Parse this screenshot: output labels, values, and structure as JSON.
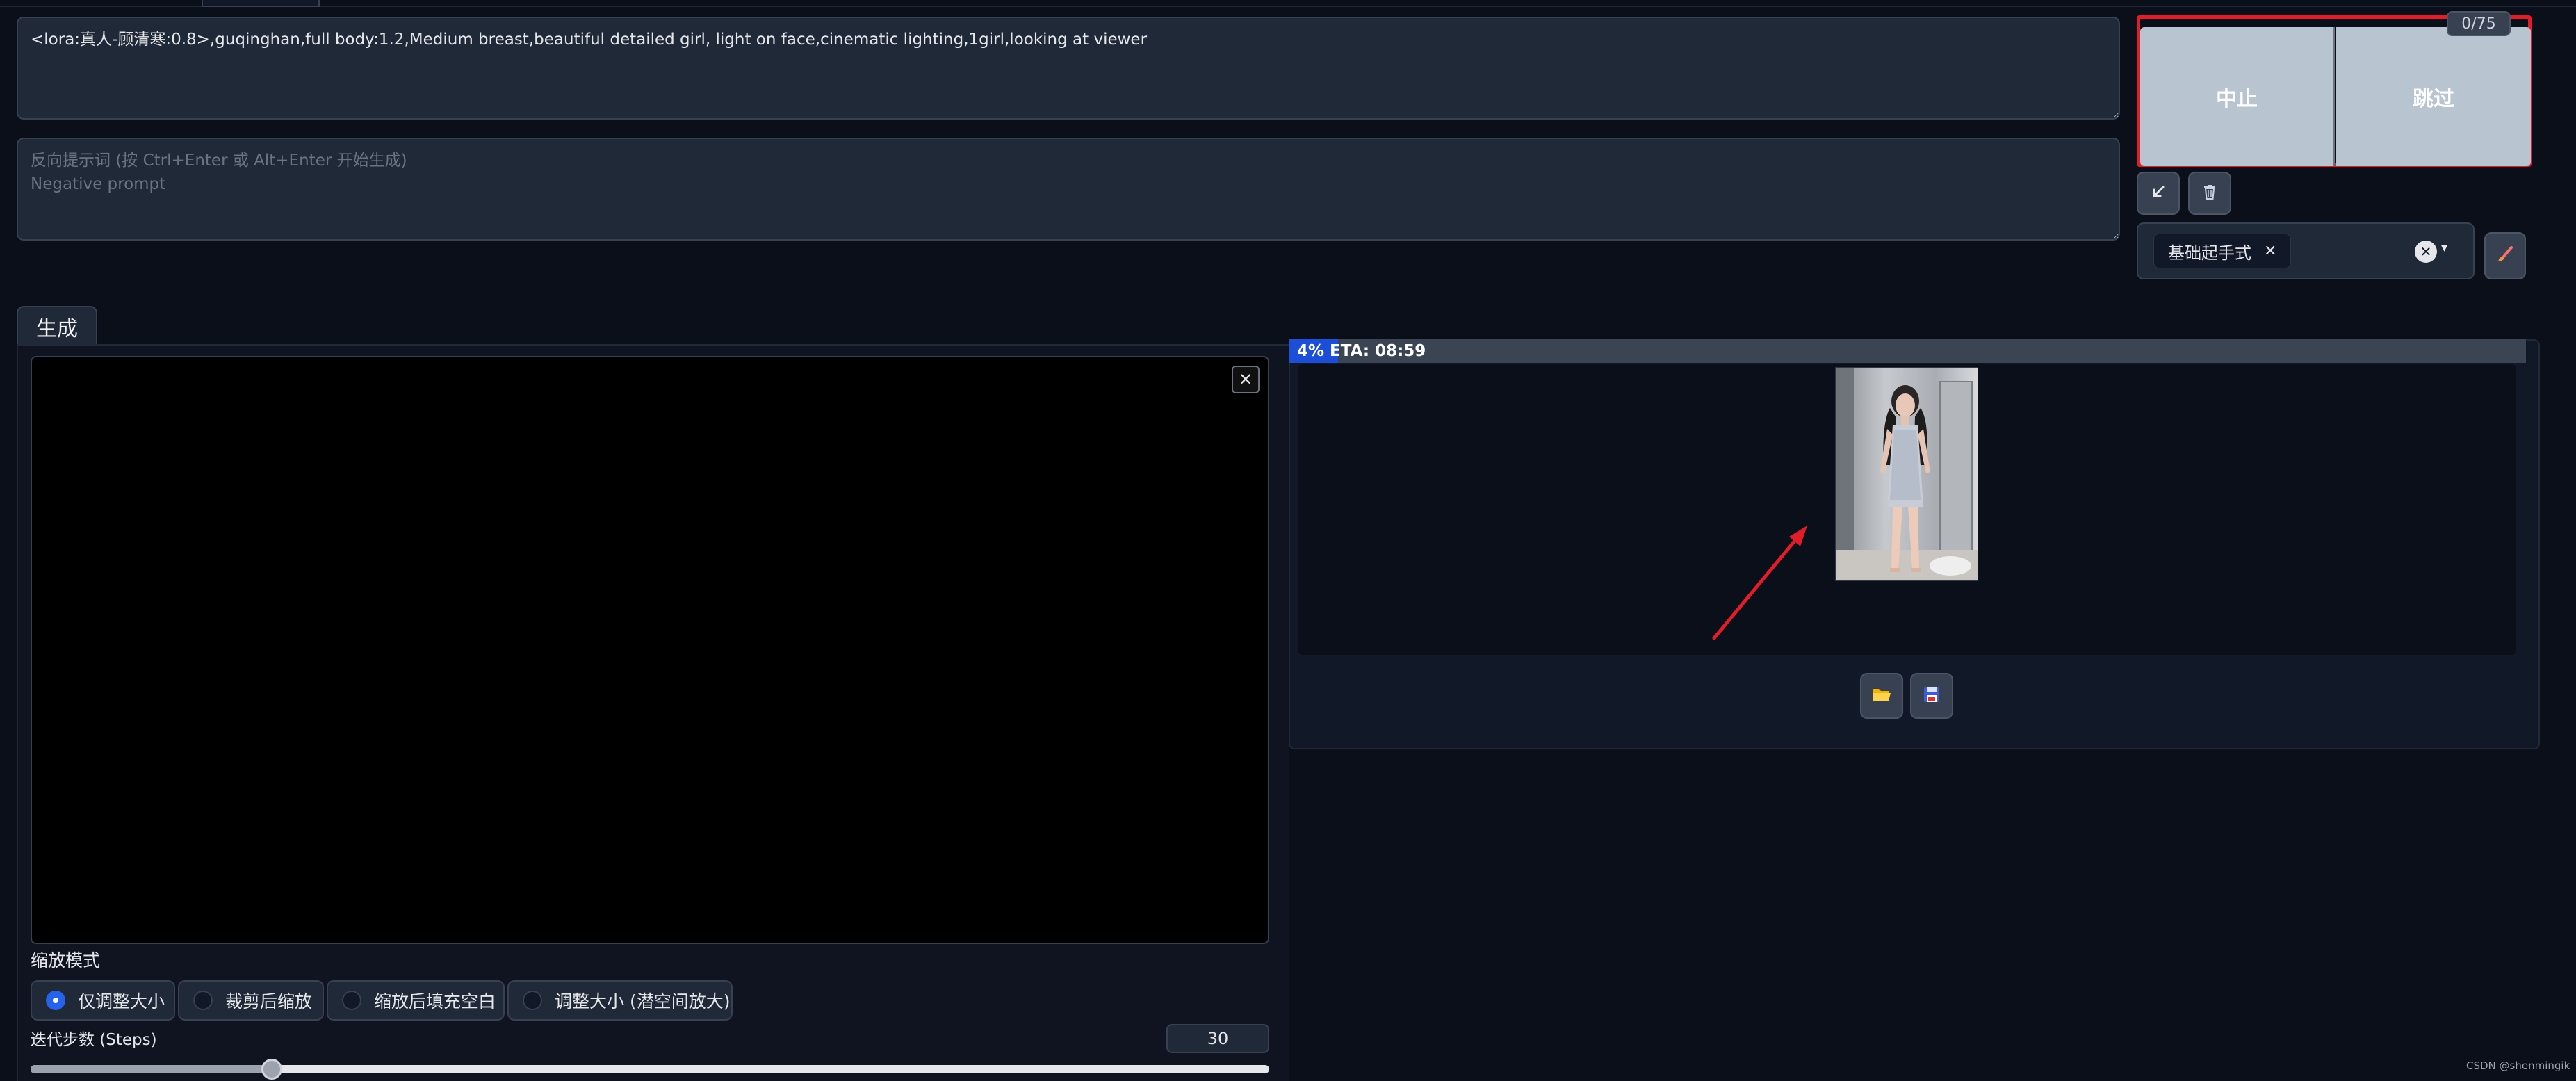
{
  "prompt": {
    "positive_value": "<lora:真人-顾清寒:0.8>,guqinghan,full body:1.2,Medium breast,beautiful detailed girl, light on face,cinematic lighting,1girl,looking at viewer",
    "negative_placeholder": "反向提示词 (按 Ctrl+Enter 或 Alt+Enter 开始生成)\nNegative prompt"
  },
  "generate": {
    "interrupt_label": "中止",
    "skip_label": "跳过",
    "counter": "0/75"
  },
  "tools": {
    "paste_icon": "arrow-down-left-icon",
    "trash_icon": "trash-icon",
    "brush_icon": "paint-brush-icon"
  },
  "styles": {
    "selected": "基础起手式",
    "remove_icon": "close-icon",
    "clear_icon": "clear-icon",
    "dropdown_icon": "chevron-down-icon"
  },
  "tabs": [
    {
      "label": "生成",
      "active": true
    }
  ],
  "img2img": {
    "close_icon": "close-icon",
    "resize_mode_label": "缩放模式",
    "resize_modes": [
      "仅调整大小",
      "裁剪后缩放",
      "缩放后填充空白",
      "调整大小 (潜空间放大)"
    ],
    "resize_mode_selected": 0,
    "steps_label": "迭代步数 (Steps)",
    "steps_value": "30",
    "steps_min": 1,
    "steps_max": 150
  },
  "output": {
    "progress_text": "4% ETA: 08:59",
    "progress_percent": 4,
    "folder_icon": "folder-icon",
    "save_icon": "save-icon"
  },
  "watermark": "CSDN @shenmingik",
  "colors": {
    "accent": "#2563eb",
    "progress_fill": "#1d4ed8",
    "highlight_border": "#e11d2a",
    "background": "#0b0f19"
  }
}
